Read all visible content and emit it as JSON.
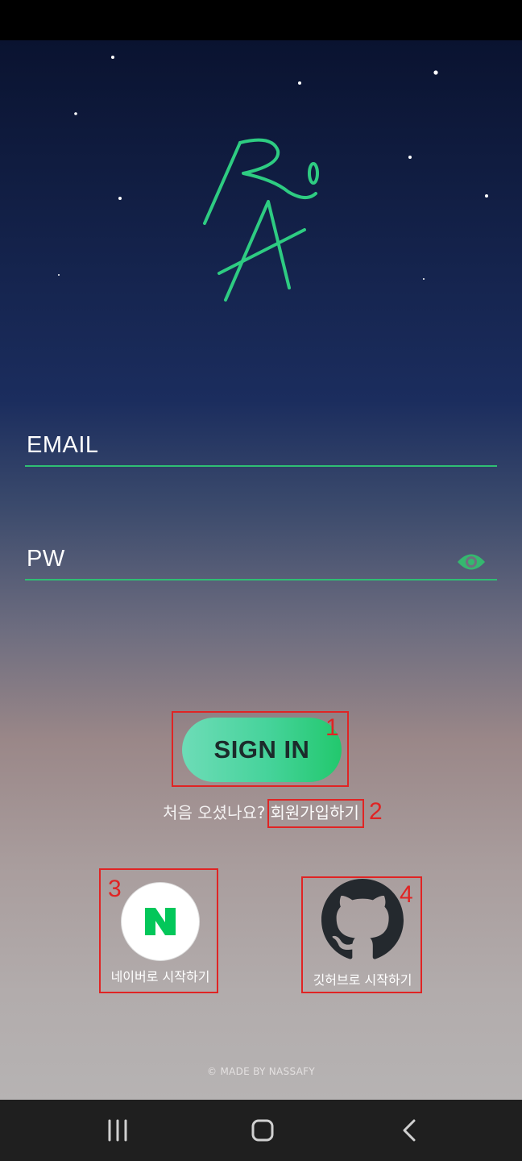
{
  "login": {
    "email_label": "EMAIL",
    "pw_label": "PW"
  },
  "actions": {
    "signin_label": "SIGN IN",
    "signup_question": "처음 오셨나요?",
    "signup_link": "회원가입하기"
  },
  "social": {
    "naver_label": "네이버로 시작하기",
    "github_label": "깃허브로 시작하기"
  },
  "footer": "© MADE BY NASSAFY",
  "annotations": [
    "1",
    "2",
    "3",
    "4"
  ],
  "icons": [
    "logo-icon",
    "eye-icon",
    "naver-icon",
    "github-icon",
    "recent-apps-icon",
    "home-icon",
    "back-icon"
  ],
  "colors": {
    "accent": "#2fbf73",
    "annotation": "#e02424",
    "naver_green": "#03c75a",
    "github": "#24292e"
  }
}
